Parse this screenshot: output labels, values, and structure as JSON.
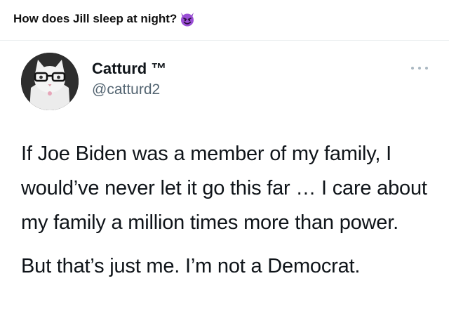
{
  "post": {
    "caption": "How does Jill sleep at night?",
    "caption_emoji": "smiling-face-with-horns-icon"
  },
  "tweet": {
    "display_name": "Catturd ™",
    "handle": "@catturd2",
    "avatar_icon": "cat-with-glasses-avatar",
    "more_icon": "more-options-icon",
    "body_paragraph_1": "If Joe Biden was a member of my family, I would’ve never let it go this far … I care about my family a million times more than power.",
    "body_paragraph_2": "But that’s just me. I’m not a Democrat."
  },
  "colors": {
    "text": "#0f1419",
    "secondary_text": "#536471",
    "emoji_purple": "#8a3fc7"
  }
}
